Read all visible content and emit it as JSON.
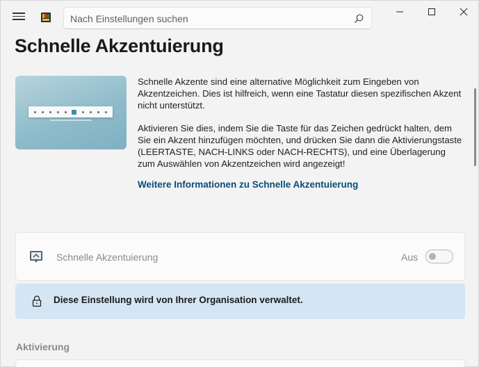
{
  "titlebar": {
    "menu_icon": "hamburger-menu-icon",
    "app_icon": "settings-app-icon",
    "search_placeholder": "Nach Einstellungen suchen",
    "search_icon": "search-icon",
    "window_controls": [
      "minimize-icon",
      "maximize-icon",
      "close-icon"
    ]
  },
  "page": {
    "title": "Schnelle Akzentuierung"
  },
  "intro": {
    "paragraph_1": "Schnelle Akzente sind eine alternative Möglichkeit zum Eingeben von Akzentzeichen. Dies ist hilfreich, wenn eine Tastatur diesen spezifischen Akzent nicht unterstützt.",
    "paragraph_2": "Aktivieren Sie dies, indem Sie die Taste für das Zeichen gedrückt halten, dem Sie ein Akzent hinzufügen möchten, und drücken Sie dann die Aktivierungstaste (LEERTASTE, NACH-LINKS oder NACH-RECHTS), und eine Überlagerung zum Auswählen von Akzentzeichen wird angezeigt!",
    "learn_more": "Weitere Informationen zu Schnelle Akzentuierung"
  },
  "setting": {
    "icon": "quick-accent-icon",
    "label": "Schnelle Akzentuierung",
    "state_label": "Aus",
    "enabled": false
  },
  "banner": {
    "icon": "lock-icon",
    "text": "Diese Einstellung wird von Ihrer Organisation verwaltet.",
    "color": "#d4e5f3"
  },
  "sections": {
    "activation_heading": "Aktivierung"
  },
  "colors": {
    "link": "#0a4c7a",
    "background": "#f3f3f3"
  }
}
